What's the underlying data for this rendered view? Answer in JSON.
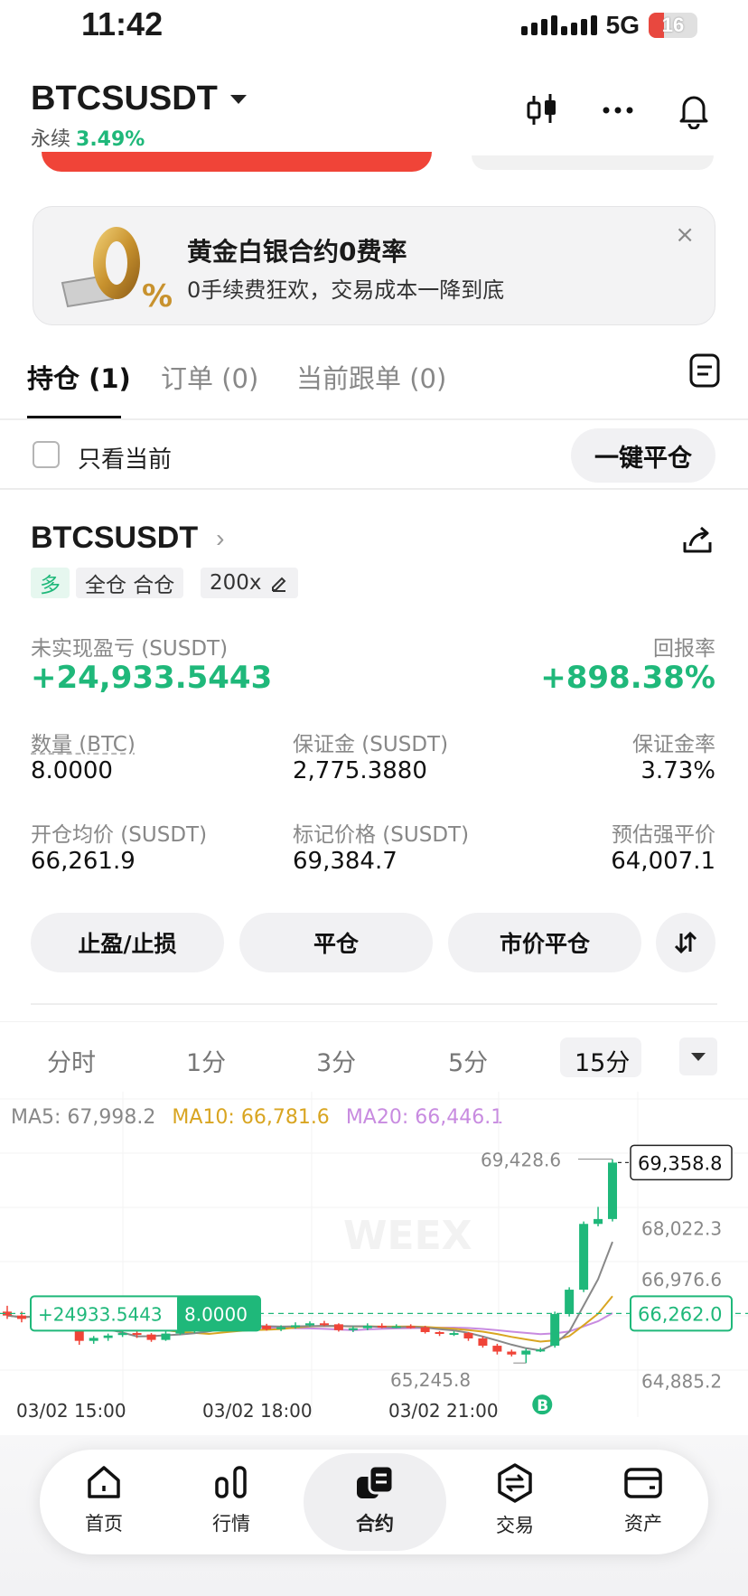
{
  "status_bar": {
    "time": "11:42",
    "network": "5G",
    "battery": "16"
  },
  "header": {
    "symbol": "BTCSUSDT",
    "contract_type": "永续",
    "change_pct": "3.49%"
  },
  "banner": {
    "title": "黄金白银合约0费率",
    "subtitle": "0手续费狂欢，交易成本一降到底",
    "close": "×"
  },
  "tabs": [
    {
      "label": "持仓 (1)",
      "active": true
    },
    {
      "label": "订单 (0)",
      "active": false
    },
    {
      "label": "当前跟单 (0)",
      "active": false
    }
  ],
  "filter": {
    "only_current": "只看当前",
    "close_all": "一键平仓"
  },
  "position": {
    "symbol": "BTCSUSDT",
    "side": "多",
    "margin_mode": "全仓 合仓",
    "leverage": "200x",
    "unrealized_pnl_label": "未实现盈亏 (SUSDT)",
    "unrealized_pnl": "+24,933.5443",
    "roe_label": "回报率",
    "roe": "+898.38%",
    "size_label": "数量 (BTC)",
    "size": "8.0000",
    "margin_label": "保证金 (SUSDT)",
    "margin": "2,775.3880",
    "margin_ratio_label": "保证金率",
    "margin_ratio": "3.73%",
    "entry_label": "开仓均价 (SUSDT)",
    "entry": "66,261.9",
    "mark_label": "标记价格 (SUSDT)",
    "mark": "69,384.7",
    "liq_label": "预估强平价",
    "liq": "64,007.1",
    "buttons": [
      "止盈/止损",
      "平仓",
      "市价平仓"
    ]
  },
  "intervals": [
    {
      "label": "分时",
      "active": false
    },
    {
      "label": "1分",
      "active": false
    },
    {
      "label": "3分",
      "active": false
    },
    {
      "label": "5分",
      "active": false
    },
    {
      "label": "15分",
      "active": true
    }
  ],
  "chart": {
    "ma5": "MA5: 67,998.2",
    "ma10": "MA10: 66,781.6",
    "ma20": "MA20: 66,446.1",
    "high_label": "69,428.6",
    "low_label": "65,245.8",
    "last_price": "69,358.8",
    "entry_price": "66,262.0",
    "position_pnl": "+24933.5443",
    "position_size": "8.0000",
    "buy_marker": "B",
    "y_ticks": [
      "68,022.3",
      "66,976.6",
      "64,885.2"
    ],
    "x_ticks": [
      "03/02 15:00",
      "03/02 18:00",
      "03/02 21:00"
    ],
    "watermark": "WEEX",
    "colors": {
      "up": "#1fb87a",
      "down": "#f04438"
    }
  },
  "chart_data": {
    "type": "candlestick",
    "y_range": [
      64600,
      69700
    ],
    "candles": [
      {
        "o": 66300,
        "c": 66220,
        "h": 66420,
        "l": 66150
      },
      {
        "o": 66220,
        "c": 66150,
        "h": 66300,
        "l": 66080
      },
      {
        "o": 66150,
        "c": 66230,
        "h": 66290,
        "l": 66100
      },
      {
        "o": 66240,
        "c": 66180,
        "h": 66300,
        "l": 66120
      },
      {
        "o": 66190,
        "c": 66220,
        "h": 66270,
        "l": 66150
      },
      {
        "o": 65900,
        "c": 65700,
        "h": 65980,
        "l": 65620
      },
      {
        "o": 65700,
        "c": 65760,
        "h": 65800,
        "l": 65640
      },
      {
        "o": 65760,
        "c": 65810,
        "h": 65850,
        "l": 65700
      },
      {
        "o": 65820,
        "c": 65860,
        "h": 65900,
        "l": 65780
      },
      {
        "o": 65860,
        "c": 65830,
        "h": 65900,
        "l": 65760
      },
      {
        "o": 65830,
        "c": 65720,
        "h": 65860,
        "l": 65680
      },
      {
        "o": 65720,
        "c": 65850,
        "h": 65900,
        "l": 65700
      },
      {
        "o": 65850,
        "c": 65900,
        "h": 65960,
        "l": 65820
      },
      {
        "o": 65900,
        "c": 65980,
        "h": 66020,
        "l": 65860
      },
      {
        "o": 65980,
        "c": 66020,
        "h": 66060,
        "l": 65950
      },
      {
        "o": 66020,
        "c": 65990,
        "h": 66070,
        "l": 65950
      },
      {
        "o": 65990,
        "c": 66040,
        "h": 66080,
        "l": 65960
      },
      {
        "o": 66040,
        "c": 66010,
        "h": 66090,
        "l": 65970
      },
      {
        "o": 66010,
        "c": 65940,
        "h": 66050,
        "l": 65910
      },
      {
        "o": 65940,
        "c": 65980,
        "h": 66020,
        "l": 65900
      },
      {
        "o": 65980,
        "c": 66020,
        "h": 66080,
        "l": 65950
      },
      {
        "o": 66020,
        "c": 66060,
        "h": 66100,
        "l": 65990
      },
      {
        "o": 66060,
        "c": 66040,
        "h": 66110,
        "l": 66000
      },
      {
        "o": 66040,
        "c": 65920,
        "h": 66060,
        "l": 65890
      },
      {
        "o": 65920,
        "c": 65960,
        "h": 66000,
        "l": 65880
      },
      {
        "o": 65960,
        "c": 66010,
        "h": 66060,
        "l": 65920
      },
      {
        "o": 66010,
        "c": 65990,
        "h": 66060,
        "l": 65960
      },
      {
        "o": 65990,
        "c": 66000,
        "h": 66040,
        "l": 65960
      },
      {
        "o": 66000,
        "c": 65980,
        "h": 66040,
        "l": 65950
      },
      {
        "o": 65980,
        "c": 65880,
        "h": 66010,
        "l": 65850
      },
      {
        "o": 65880,
        "c": 65850,
        "h": 65900,
        "l": 65800
      },
      {
        "o": 65850,
        "c": 65860,
        "h": 65900,
        "l": 65800
      },
      {
        "o": 65860,
        "c": 65750,
        "h": 65880,
        "l": 65700
      },
      {
        "o": 65750,
        "c": 65600,
        "h": 65790,
        "l": 65560
      },
      {
        "o": 65600,
        "c": 65480,
        "h": 65640,
        "l": 65420
      },
      {
        "o": 65480,
        "c": 65420,
        "h": 65520,
        "l": 65380
      },
      {
        "o": 65420,
        "c": 65500,
        "h": 65540,
        "l": 65245
      },
      {
        "o": 65500,
        "c": 65520,
        "h": 65560,
        "l": 65470
      },
      {
        "o": 65600,
        "c": 66250,
        "h": 66300,
        "l": 65560
      },
      {
        "o": 66250,
        "c": 66750,
        "h": 66800,
        "l": 66200
      },
      {
        "o": 66750,
        "c": 68100,
        "h": 68150,
        "l": 66700
      },
      {
        "o": 68100,
        "c": 68200,
        "h": 68450,
        "l": 68050
      },
      {
        "o": 68200,
        "c": 69358,
        "h": 69428,
        "l": 68150
      }
    ]
  }
}
